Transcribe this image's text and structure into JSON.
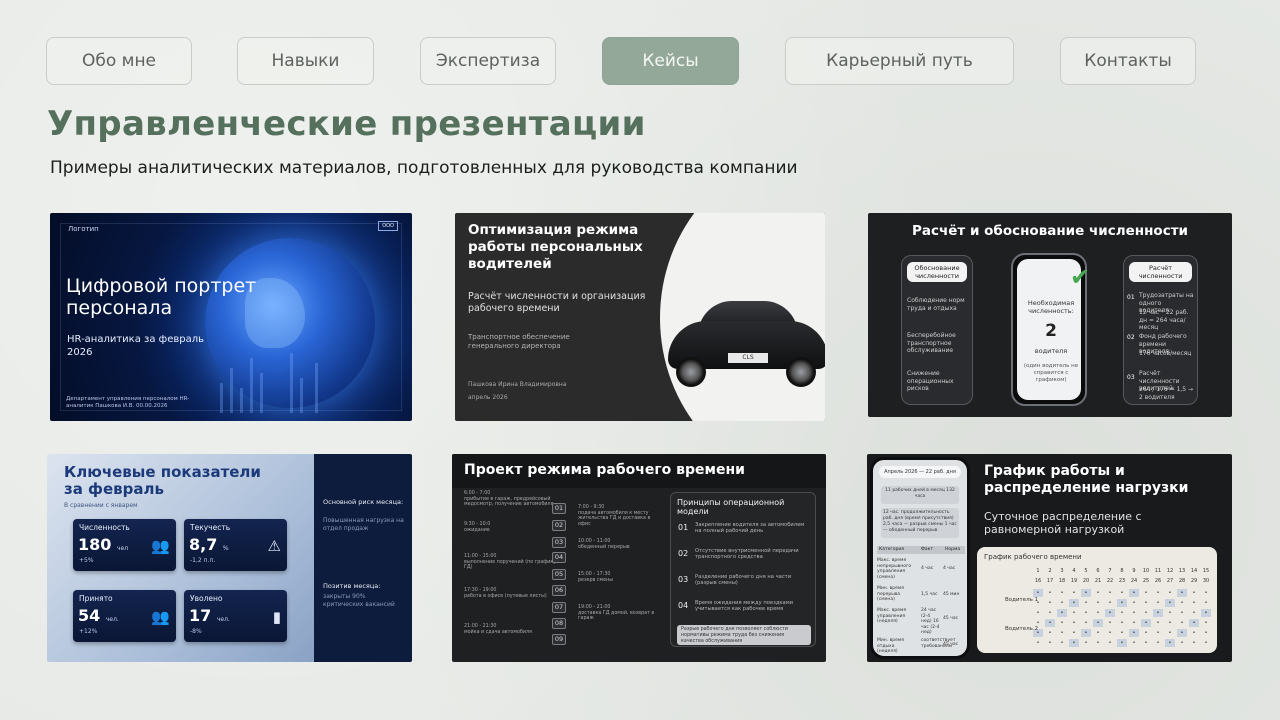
{
  "nav": {
    "items": [
      {
        "label": "Обо мне"
      },
      {
        "label": "Навыки"
      },
      {
        "label": "Экспертиза"
      },
      {
        "label": "Кейсы",
        "active": true
      },
      {
        "label": "Карьерный путь"
      },
      {
        "label": "Контакты"
      }
    ]
  },
  "page": {
    "title": "Управленческие презентации",
    "subtitle": "Примеры аналитических материалов, подготовленных для руководства компании"
  },
  "colors": {
    "accent": "#55705c",
    "nav_active": "#94a89a",
    "background": "#e6e9e5"
  },
  "cards": {
    "c1": {
      "logo": "Логотип",
      "badge": "ООО",
      "title": "Цифровой портрет персонала",
      "subtitle": "HR-аналитика за февраль 2026",
      "footer": "Департамент управления персоналом HR-аналитик Пашкова И.В. 00.00.2026"
    },
    "c2": {
      "title": "Оптимизация режима работы персональных водителей",
      "subtitle": "Расчёт численности и организация рабочего времени",
      "subtitle2": "Транспортное обеспечение генерального директора",
      "author": "Пашкова Ирина Владимировна",
      "date": "апрель 2026",
      "plate": "CLS"
    },
    "c3": {
      "title": "Расчёт и обоснование численности",
      "left_pill": "Обоснование численности",
      "left_items": [
        "Соблюдение норм труда и отдыха",
        "Бесперебойное транспортное обслуживание",
        "Снижение операционных рисков"
      ],
      "phone_label": "Необходимая численность:",
      "phone_value": "2",
      "phone_unit": "водителя",
      "phone_note": "(один водитель не справится с графиком)",
      "right_pill": "Расчёт численности",
      "right_items": [
        {
          "n": "01",
          "t": "Трудозатраты на одного водителя:",
          "d": "12 час * 22 раб. дн = 264 часа/месяц"
        },
        {
          "n": "02",
          "t": "Фонд рабочего времени водителя:",
          "d": "176 часов/месяц"
        },
        {
          "n": "03",
          "t": "Расчёт численности водителей:",
          "d": "264 / 176 = 1,5 → 2 водителя"
        }
      ]
    },
    "c4": {
      "title": "Ключевые показатели за февраль",
      "subtitle": "В сравнении с январем",
      "kpis": [
        {
          "label": "Численность",
          "value": "180",
          "unit": "чел",
          "delta": "+5%",
          "icon": "people-growth-icon"
        },
        {
          "label": "Текучесть",
          "value": "8,7",
          "unit": "%",
          "delta": "-1,2 п.п.",
          "icon": "warning-icon"
        },
        {
          "label": "Принято",
          "value": "54",
          "unit": "чел.",
          "delta": "+12%",
          "icon": "people-icon"
        },
        {
          "label": "Уволено",
          "value": "17",
          "unit": "чел.",
          "delta": "-8%",
          "icon": "bar-chart-icon"
        }
      ],
      "risk_title": "Основной риск месяца:",
      "risk_text": "Повышенная нагрузка на отдел продаж",
      "positive_title": "Позитив месяца:",
      "positive_text": "закрыты 90% критических вакансий"
    },
    "c5": {
      "title": "Проект режима рабочего времени",
      "timeline_left": [
        {
          "time": "6:00 - 7:00",
          "text": "прибытие в гараж, предрейсовый медосмотр, получение автомобиля"
        },
        {
          "time": "9:30 - 10:0",
          "text": "ожидание"
        },
        {
          "time": "11:00 - 15:00",
          "text": "выполнение поручений (по графику ГД)"
        },
        {
          "time": "17:30 - 19:00",
          "text": "работа в офисе (путевые листы)"
        },
        {
          "time": "21:00 - 21:30",
          "text": "мойка и сдача автомобиля"
        }
      ],
      "timeline_right": [
        {
          "time": "7:00 - 9:30",
          "text": "подача автомобиля к месту жительства ГД и доставка в офис"
        },
        {
          "time": "10:00 - 11:00",
          "text": "обеденный перерыв"
        },
        {
          "time": "15:00 - 17:30",
          "text": "резерв смены"
        },
        {
          "time": "19:00 - 21:00",
          "text": "доставка ГД домой, возврат в гараж"
        }
      ],
      "numbers": [
        "01",
        "02",
        "03",
        "04",
        "05",
        "06",
        "07",
        "08",
        "09"
      ],
      "principles_title": "Принципы операционной модели",
      "principles": [
        {
          "n": "01",
          "t": "Закрепление водителя за автомобилем на полный рабочий день"
        },
        {
          "n": "02",
          "t": "Отсутствие внутрисменной передачи транспортного средства"
        },
        {
          "n": "03",
          "t": "Разделение рабочего дня на части (разрыв смены)"
        },
        {
          "n": "04",
          "t": "Время ожидания между поездками учитывается как рабочее время"
        }
      ],
      "note": "Разрыв рабочего дня позволяет соблюсти нормативы режима труда без снижения качества обслуживания"
    },
    "c6": {
      "phone_header": "Апрель 2026 — 22 раб. дня",
      "phone_box1": "11 рабочих дней в месяц 132 часа",
      "phone_box2": "12 час. продолжительность раб. дня (время присутствия) 2,5 часа — разрыв смены 1 час — обеденный перерыв",
      "phone_table_head": [
        "Категория",
        "Факт",
        "Норма"
      ],
      "phone_rows": [
        {
          "c": "Макс. время непрерывного управления (смена)",
          "f": "4 час",
          "n": "4 час"
        },
        {
          "c": "Мин. время перерыва (смена)",
          "f": "1,5 час",
          "n": "45 мин"
        },
        {
          "c": "Макс. время управления (неделя)",
          "f": "24 час (2-4 нед) 16 час (2-4 нед)",
          "n": "45 час"
        },
        {
          "c": "Мин. время отдыха (неделя)",
          "f": "соответствует требованиям",
          "n": "45 час"
        }
      ],
      "title": "График работы и распределение нагрузки",
      "subtitle": "Суточное распределение с равномерной нагрузкой",
      "schedule_title": "График рабочего времени",
      "days_row1": [
        "1",
        "2",
        "3",
        "4",
        "5",
        "6",
        "7",
        "8",
        "9",
        "10",
        "11",
        "12",
        "13",
        "14",
        "15"
      ],
      "days_row2": [
        "16",
        "17",
        "18",
        "19",
        "20",
        "21",
        "22",
        "23",
        "24",
        "25",
        "26",
        "27",
        "28",
        "29",
        "30"
      ],
      "drivers": [
        "Водитель 1",
        "Водитель 2"
      ]
    }
  }
}
